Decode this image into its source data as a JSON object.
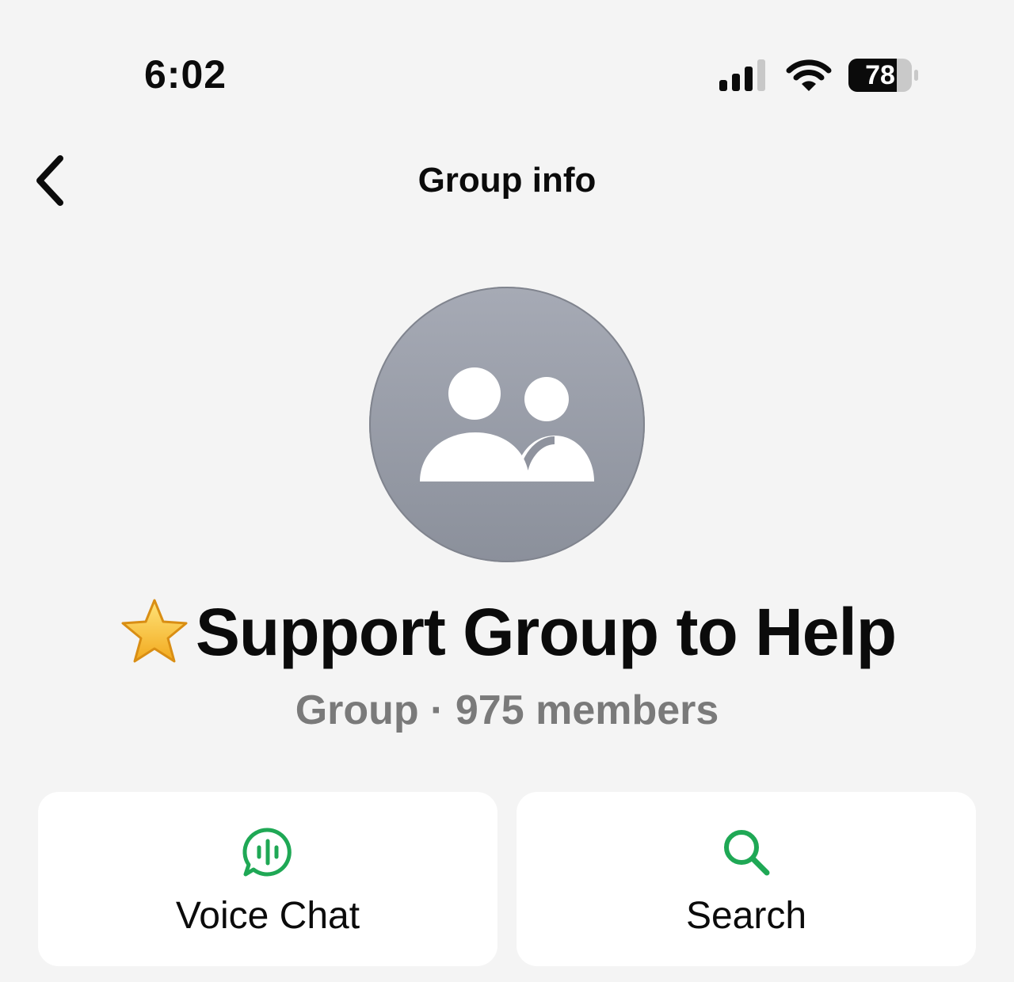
{
  "status_bar": {
    "time": "6:02",
    "battery_level": "78",
    "icons": [
      "signal-icon",
      "wifi-icon",
      "battery-icon"
    ]
  },
  "nav": {
    "back_icon": "chevron-left-icon",
    "title": "Group info"
  },
  "group": {
    "avatar_icon": "group-people-icon",
    "name_emoji_icon": "star-icon",
    "name": "Support Group to Help",
    "subtitle": "Group · 975 members"
  },
  "actions": [
    {
      "label": "Voice Chat",
      "icon": "voice-chat-icon"
    },
    {
      "label": "Search",
      "icon": "search-icon"
    }
  ],
  "colors": {
    "background": "#f4f4f4",
    "card": "#ffffff",
    "accent_green": "#1fa855",
    "avatar_gray": "#9a9ea9",
    "subtitle_gray": "#7a7a7a",
    "star_yellow": "#f7c232"
  }
}
